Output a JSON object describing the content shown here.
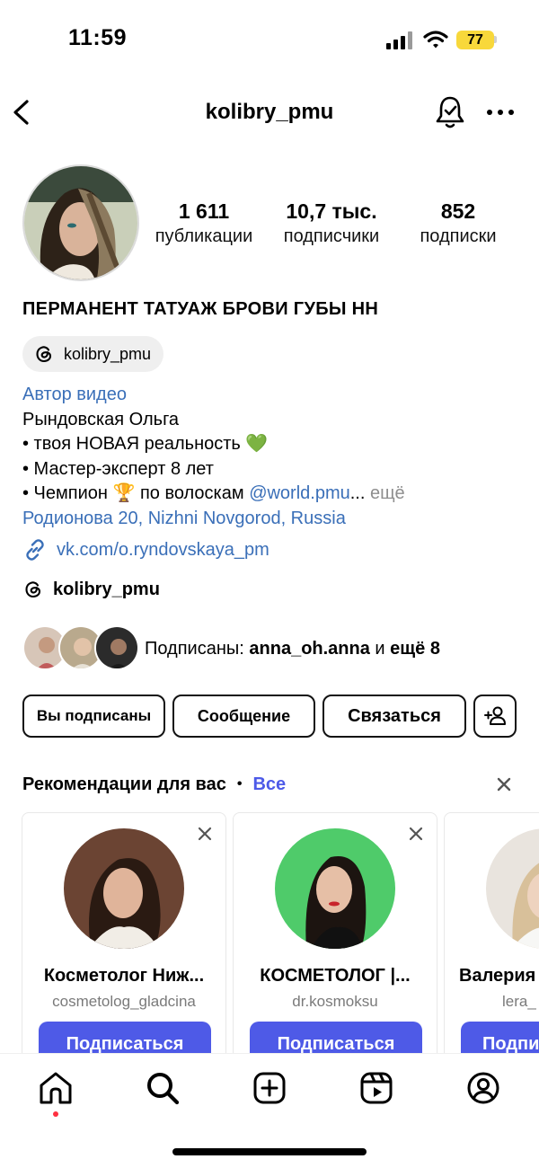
{
  "status_bar": {
    "time": "11:59",
    "battery": "77",
    "battery_color": "#f8d83b"
  },
  "header": {
    "username": "kolibry_pmu",
    "back_icon": "chevron-left-icon",
    "bell_icon": "bell-icon",
    "more_icon": "more-horizontal-icon"
  },
  "stats": [
    {
      "value": "1 611",
      "label": "публикации"
    },
    {
      "value": "10,7 тыс.",
      "label": "подписчики"
    },
    {
      "value": "852",
      "label": "подписки"
    }
  ],
  "profile": {
    "title": "ПЕРМАНЕНТ ТАТУАЖ БРОВИ ГУБЫ НН",
    "threads_chip": "kolibry_pmu",
    "category": "Автор видео",
    "bio_lines": [
      "Рындовская Ольга",
      "• твоя НОВАЯ реальность 💚",
      "• Мастер-эксперт 8 лет"
    ],
    "bio_last_prefix": "• Чемпион 🏆 по волоскам ",
    "bio_mention": "@world.pmu",
    "bio_ellipsis": "...",
    "bio_more": " ещё",
    "address": "Родионова 20, Nizhni Novgorod, Russia",
    "website": "vk.com/o.ryndovskaya_pm",
    "threads_handle": "kolibry_pmu"
  },
  "followed_by": {
    "prefix": "Подписаны: ",
    "name": "anna_oh.anna",
    "middle": " и ",
    "rest": "ещё 8"
  },
  "actions": {
    "following": "Вы подписаны",
    "message": "Сообщение",
    "contact": "Связаться",
    "add_user_icon": "add-person-icon"
  },
  "recommendations": {
    "title": "Рекомендации для вас",
    "dot": "•",
    "see_all": "Все",
    "cards": [
      {
        "name": "Косметолог Ниж...",
        "handle": "cosmetolog_gladcina",
        "button": "Подписаться"
      },
      {
        "name": "КОСМЕТОЛОГ |...",
        "handle": "dr.kosmoksu",
        "button": "Подписаться"
      },
      {
        "name": "Валерия",
        "handle": "lera_",
        "button": "Подпи"
      }
    ]
  },
  "tab_bar": {
    "items": [
      "home-icon",
      "search-icon",
      "create-icon",
      "reels-icon",
      "profile-icon"
    ],
    "accent": "#4e5ae7",
    "notification_dot": "#ff3040"
  }
}
